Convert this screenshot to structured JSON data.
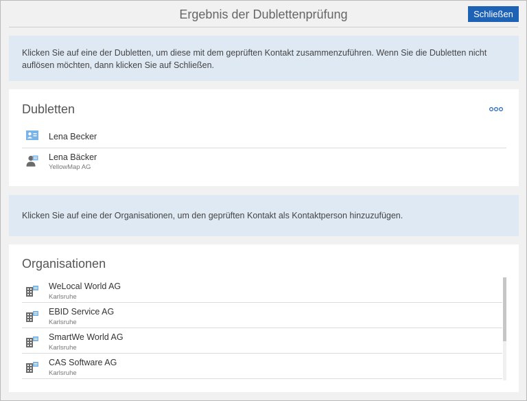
{
  "header": {
    "title": "Ergebnis der Dublettenprüfung",
    "close_label": "Schließen"
  },
  "info_duplicates": "Klicken Sie auf eine der Dubletten, um diese mit dem geprüften Kontakt zusammenzuführen. Wenn Sie die Dubletten nicht auflösen möchten, dann klicken Sie auf Schließen.",
  "duplicates": {
    "title": "Dubletten",
    "items": [
      {
        "name": "Lena Becker",
        "sub": "",
        "icon": "contact-card-icon"
      },
      {
        "name": "Lena Bäcker",
        "sub": "YellowMap AG",
        "icon": "person-contact-icon"
      }
    ]
  },
  "info_organizations": "Klicken Sie auf eine der Organisationen, um den geprüften Kontakt als Kontaktperson hinzuzufügen.",
  "organizations": {
    "title": "Organisationen",
    "items": [
      {
        "name": "WeLocal World AG",
        "sub": "Karlsruhe",
        "icon": "building-icon"
      },
      {
        "name": "EBID Service AG",
        "sub": "Karlsruhe",
        "icon": "building-icon"
      },
      {
        "name": "SmartWe World AG",
        "sub": "Karlsruhe",
        "icon": "building-icon"
      },
      {
        "name": "CAS Software AG",
        "sub": "Karlsruhe",
        "icon": "building-icon"
      }
    ]
  },
  "colors": {
    "accent": "#1e62b6",
    "info_background": "#dfe9f4",
    "icon_blue": "#7ab4e6",
    "icon_gray": "#6b6b6b"
  }
}
